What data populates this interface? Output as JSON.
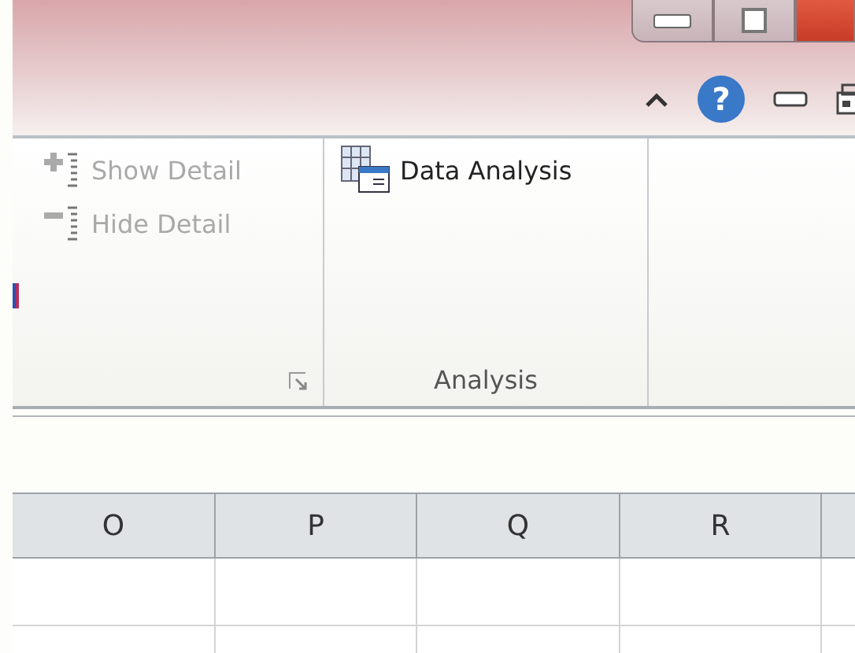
{
  "help_icon": "?",
  "ribbon": {
    "groups": [
      {
        "launcher": true,
        "buttons": [
          {
            "label": "Show Detail",
            "kind": "show",
            "disabled": true
          },
          {
            "label": "Hide Detail",
            "kind": "hide",
            "disabled": true
          }
        ]
      },
      {
        "label": "Analysis",
        "launcher": false,
        "buttons": [
          {
            "label": "Data Analysis",
            "kind": "analysis",
            "disabled": false
          }
        ]
      }
    ]
  },
  "sheet": {
    "columns": [
      "O",
      "P",
      "Q",
      "R",
      ""
    ]
  }
}
